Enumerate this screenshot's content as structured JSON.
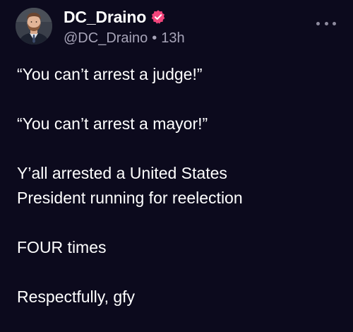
{
  "author": {
    "display_name": "DC_Draino",
    "handle": "@DC_Draino",
    "separator": "•",
    "timestamp": "13h",
    "verified": true,
    "badge_color": "#f2457c",
    "avatar_icon": "profile-photo"
  },
  "menu": {
    "icon": "more-horizontal-icon"
  },
  "post": {
    "paragraphs": [
      "“You can’t arrest a judge!”",
      "“You can’t arrest a mayor!”",
      "Y’all arrested a United States\nPresident running for reelection",
      "FOUR times",
      "Respectfully, gfy"
    ]
  },
  "colors": {
    "background": "#0c0a1d",
    "text": "#ffffff",
    "secondary_text": "#a7a4b8"
  }
}
